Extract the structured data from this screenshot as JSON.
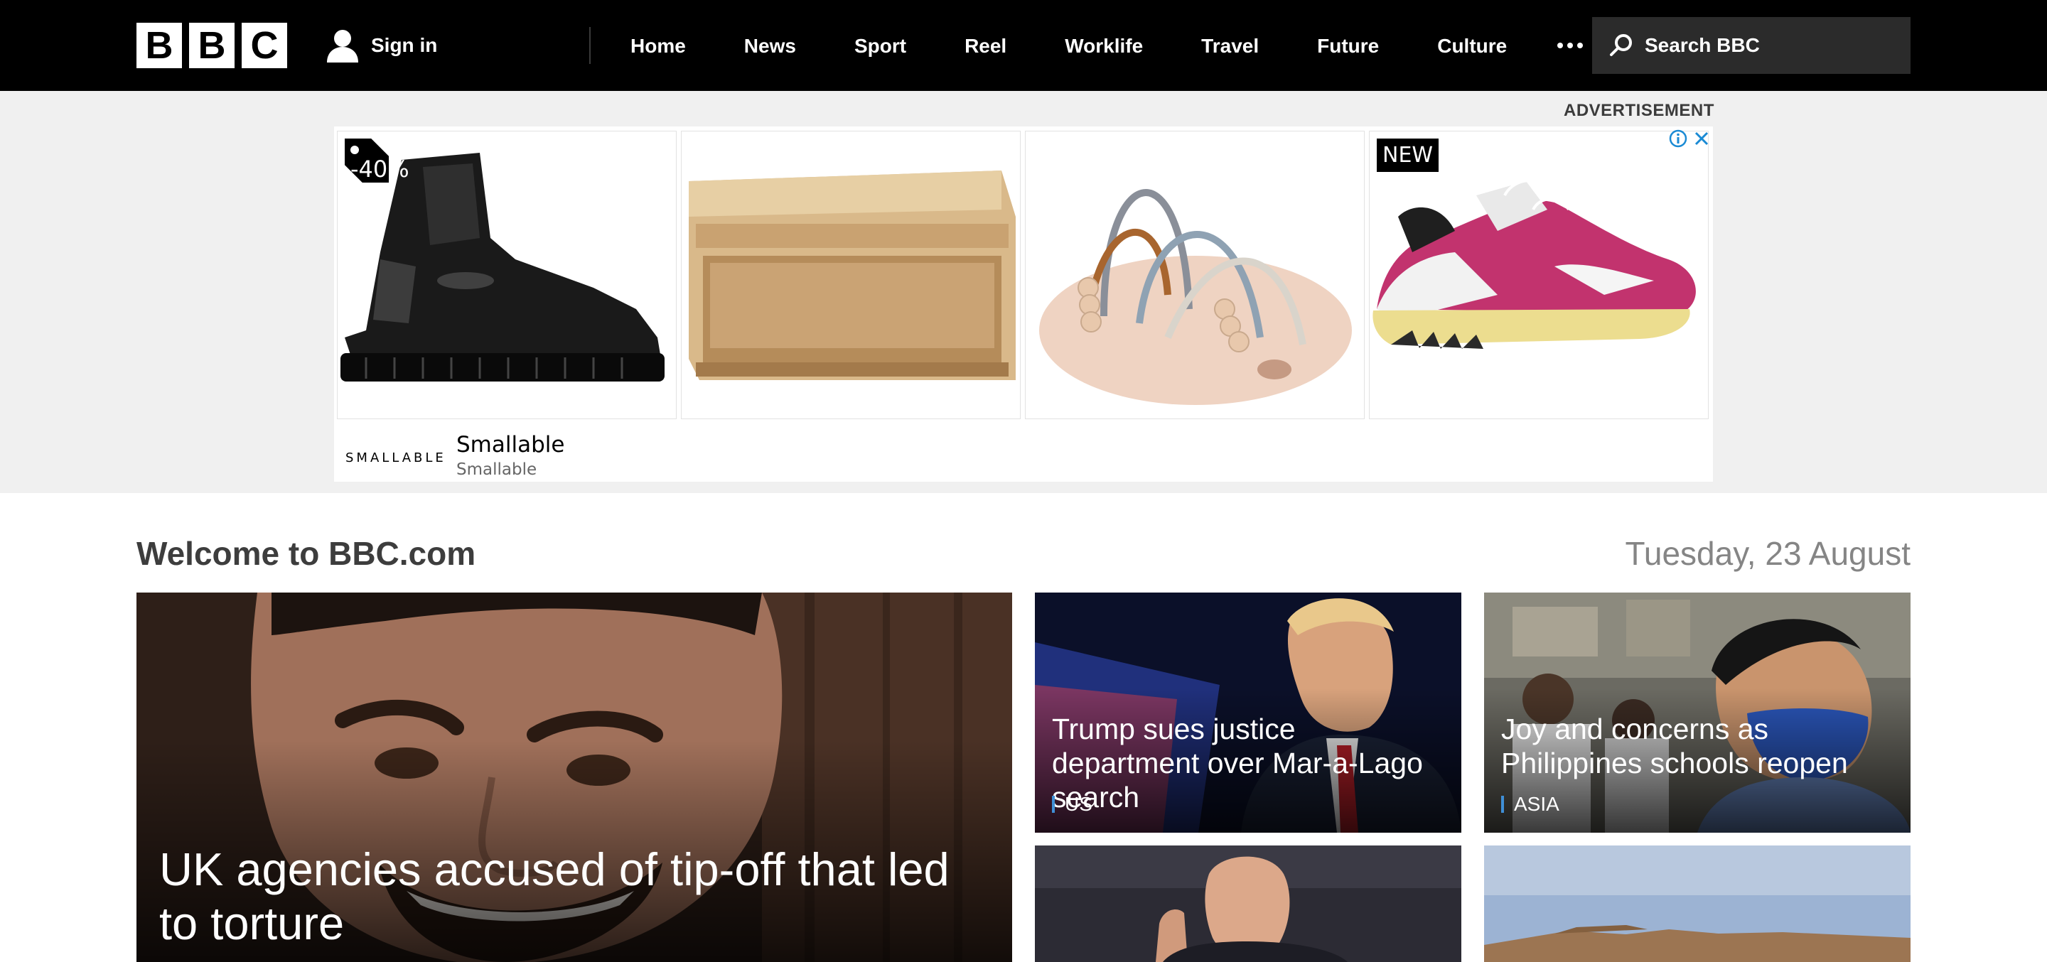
{
  "header": {
    "logo_letters": [
      "B",
      "B",
      "C"
    ],
    "sign_in_label": "Sign in",
    "nav": [
      "Home",
      "News",
      "Sport",
      "Reel",
      "Worklife",
      "Travel",
      "Future",
      "Culture"
    ],
    "search_placeholder": "Search BBC"
  },
  "ad": {
    "label": "ADVERTISEMENT",
    "products": [
      {
        "badge": "-40%",
        "icon": "black-leather-boot"
      },
      {
        "badge": "",
        "icon": "wooden-shelf"
      },
      {
        "badge": "",
        "icon": "wooden-bead-maze-toy"
      },
      {
        "badge": "NEW",
        "icon": "pink-sneaker"
      }
    ],
    "brand_logo": "SMALLABLE",
    "brand_title": "Smallable",
    "brand_subtitle": "Smallable"
  },
  "welcome": {
    "title": "Welcome to BBC.com",
    "date": "Tuesday, 23 August"
  },
  "stories": {
    "main": {
      "headline": "UK agencies accused of tip-off that led to torture"
    },
    "top_middle": {
      "headline": "Trump sues justice department over Mar-a-Lago search",
      "section": "US"
    },
    "top_right": {
      "headline": "Joy and concerns as Philippines schools reopen",
      "section": "ASIA"
    }
  },
  "colors": {
    "nav_bg": "#000000",
    "ad_band_bg": "#f0f0f0",
    "section_accent": "#3f8fd6"
  }
}
